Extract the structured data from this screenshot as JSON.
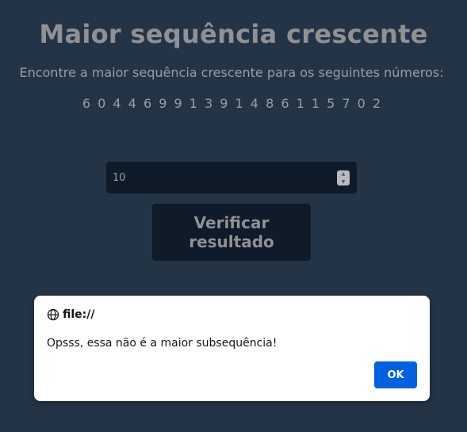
{
  "page": {
    "title": "Maior sequência crescente",
    "subtitle": "Encontre a maior sequência crescente para os seguintes números:",
    "numbers": "6 0 4 4 6 9 9 1 3 9 1 4 8 6 1 1 5 7 0 2"
  },
  "answer_input": {
    "value": "10"
  },
  "verify_button": {
    "label": "Verificar resultado"
  },
  "dialog": {
    "origin": "file://",
    "message": "Opsss, essa não é a maior subsequência!",
    "ok_label": "OK"
  },
  "colors": {
    "background": "#243447",
    "surface": "#0f1b29",
    "accent": "#0060df"
  }
}
